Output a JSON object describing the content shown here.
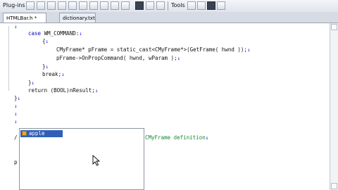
{
  "toolbar": {
    "plugins_label": "Plug-ins",
    "tools_label": "Tools"
  },
  "tabs": [
    {
      "label": "HTMLBar.h *",
      "active": true
    },
    {
      "label": "dictionary.txt",
      "active": false
    }
  ],
  "code": [
    {
      "text": "",
      "eol": "↓"
    },
    {
      "kw": "case",
      "text": " WM_COMMAND:",
      "eol": "↓"
    },
    {
      "text": "{",
      "eol": "↓"
    },
    {
      "text": "CMyFrame* pFrame = static_cast<CMyFrame*>(GetFrame( hwnd ));",
      "eol": "↓"
    },
    {
      "text": "pFrame->OnPropCommand( hwnd, wParam );",
      "eol": "↓"
    },
    {
      "text": "}",
      "eol": "↓"
    },
    {
      "text": "break;",
      "eol": "↓"
    },
    {
      "text": "}",
      "eol": "↓"
    },
    {
      "text": "return (BOOL)nResult;",
      "eol": "↓"
    },
    {
      "text": "}",
      "eol": "↓"
    },
    {
      "text": "",
      "eol": "↓"
    },
    {
      "text": "",
      "eol": "↓"
    },
    {
      "text": "",
      "eol": "↓"
    },
    {
      "text": "/",
      "eol": ""
    },
    {
      "text": "",
      "eol": ""
    },
    {
      "text": "p",
      "eol": ""
    }
  ],
  "partial_comment": "CMyFrame definition",
  "partial_comment_eol": "↓",
  "autocomplete": {
    "items": [
      {
        "label": "apple",
        "selected": true
      }
    ]
  }
}
